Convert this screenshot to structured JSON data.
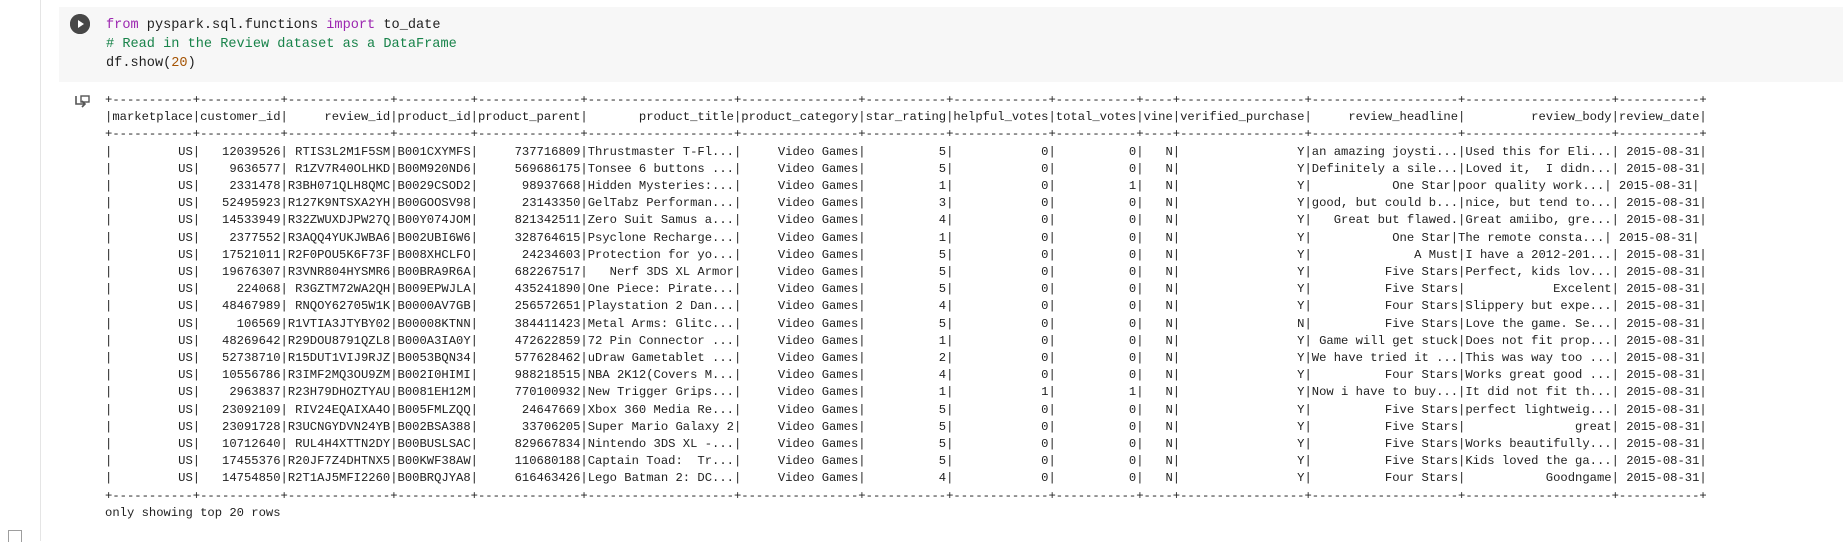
{
  "code": {
    "line1": {
      "kw1": "from",
      "module": " pyspark.sql.functions ",
      "kw2": "import",
      "name": " to_date"
    },
    "line2": "# Read in the Review dataset as a DataFrame",
    "line3": {
      "prefix": "df.show(",
      "arg": "20",
      "suffix": ")"
    }
  },
  "output": {
    "table_text": "+-----------+-----------+--------------+----------+--------------+--------------------+----------------+-----------+-------------+-----------+----+-----------------+--------------------+--------------------+-----------+\n|marketplace|customer_id|     review_id|product_id|product_parent|       product_title|product_category|star_rating|helpful_votes|total_votes|vine|verified_purchase|     review_headline|         review_body|review_date|\n+-----------+-----------+--------------+----------+--------------+--------------------+----------------+-----------+-------------+-----------+----+-----------------+--------------------+--------------------+-----------+\n|         US|   12039526| RTIS3L2M1F5SM|B001CXYMFS|     737716809|Thrustmaster T-Fl...|     Video Games|          5|            0|          0|   N|                Y|an amazing joysti...|Used this for Eli...| 2015-08-31|\n|         US|    9636577| R1ZV7R40OLHKD|B00M920ND6|     569686175|Tonsee 6 buttons ...|     Video Games|          5|            0|          0|   N|                Y|Definitely a sile...|Loved it,  I didn...| 2015-08-31|\n|         US|    2331478|R3BH071QLH8QMC|B0029CSOD2|      98937668|Hidden Mysteries:...|     Video Games|          1|            0|          1|   N|                Y|           One Star|poor quality work...| 2015-08-31|\n|         US|   52495923|R127K9NTSXA2YH|B00GOOSV98|      23143350|GelTabz Performan...|     Video Games|          3|            0|          0|   N|                Y|good, but could b...|nice, but tend to...| 2015-08-31|\n|         US|   14533949|R32ZWUXDJPW27Q|B00Y074JOM|     821342511|Zero Suit Samus a...|     Video Games|          4|            0|          0|   N|                Y|   Great but flawed.|Great amiibo, gre...| 2015-08-31|\n|         US|    2377552|R3AQQ4YUKJWBA6|B002UBI6W6|     328764615|Psyclone Recharge...|     Video Games|          1|            0|          0|   N|                Y|           One Star|The remote consta...| 2015-08-31|\n|         US|   17521011|R2F0POU5K6F73F|B008XHCLFO|      24234603|Protection for yo...|     Video Games|          5|            0|          0|   N|                Y|              A Must|I have a 2012-201...| 2015-08-31|\n|         US|   19676307|R3VNR804HYSMR6|B00BRA9R6A|     682267517|   Nerf 3DS XL Armor|     Video Games|          5|            0|          0|   N|                Y|          Five Stars|Perfect, kids lov...| 2015-08-31|\n|         US|     224068| R3GZTM72WA2QH|B009EPWJLA|     435241890|One Piece: Pirate...|     Video Games|          5|            0|          0|   N|                Y|          Five Stars|            Excelent| 2015-08-31|\n|         US|   48467989| RNQOY62705W1K|B0000AV7GB|     256572651|Playstation 2 Dan...|     Video Games|          4|            0|          0|   N|                Y|          Four Stars|Slippery but expe...| 2015-08-31|\n|         US|     106569|R1VTIA3JTYBY02|B00008KTNN|     384411423|Metal Arms: Glitc...|     Video Games|          5|            0|          0|   N|                N|          Five Stars|Love the game. Se...| 2015-08-31|\n|         US|   48269642|R29DOU8791QZL8|B000A3IA0Y|     472622859|72 Pin Connector ...|     Video Games|          1|            0|          0|   N|                Y| Game will get stuck|Does not fit prop...| 2015-08-31|\n|         US|   52738710|R15DUT1VIJ9RJZ|B0053BQN34|     577628462|uDraw Gametablet ...|     Video Games|          2|            0|          0|   N|                Y|We have tried it ...|This was way too ...| 2015-08-31|\n|         US|   10556786|R3IMF2MQ3OU9ZM|B002I0HIMI|     988218515|NBA 2K12(Covers M...|     Video Games|          4|            0|          0|   N|                Y|          Four Stars|Works great good ...| 2015-08-31|\n|         US|    2963837|R23H79DHOZTYAU|B0081EH12M|     770100932|New Trigger Grips...|     Video Games|          1|            1|          1|   N|                Y|Now i have to buy...|It did not fit th...| 2015-08-31|\n|         US|   23092109| RIV24EQAIXA4O|B005FMLZQQ|      24647669|Xbox 360 Media Re...|     Video Games|          5|            0|          0|   N|                Y|          Five Stars|perfect lightweig...| 2015-08-31|\n|         US|   23091728|R3UCNGYDVN24YB|B002BSA388|      33706205|Super Mario Galaxy 2|     Video Games|          5|            0|          0|   N|                Y|          Five Stars|               great| 2015-08-31|\n|         US|   10712640| RUL4H4XTTN2DY|B00BUSLSAC|     829667834|Nintendo 3DS XL -...|     Video Games|          5|            0|          0|   N|                Y|          Five Stars|Works beautifully...| 2015-08-31|\n|         US|   17455376|R20JF7Z4DHTNX5|B00KWF38AW|     110680188|Captain Toad:  Tr...|     Video Games|          5|            0|          0|   N|                Y|          Five Stars|Kids loved the ga...| 2015-08-31|\n|         US|   14754850|R2T1AJ5MFI2260|B00BRQJYA8|     616463426|Lego Batman 2: DC...|     Video Games|          4|            0|          0|   N|                Y|          Four Stars|           Goodngame| 2015-08-31|\n+-----------+-----------+--------------+----------+--------------+--------------------+----------------+-----------+-------------+-----------+----+-----------------+--------------------+--------------------+-----------+",
    "footer": "only showing top 20 rows"
  },
  "colors": {
    "keyword": "#9c27b0",
    "comment": "#18834a",
    "number": "#a55404",
    "cell_bg": "#f7f7f7",
    "run_button": "#474747"
  },
  "icons": {
    "run": "play-circle-icon",
    "output": "output-arrow-icon"
  }
}
